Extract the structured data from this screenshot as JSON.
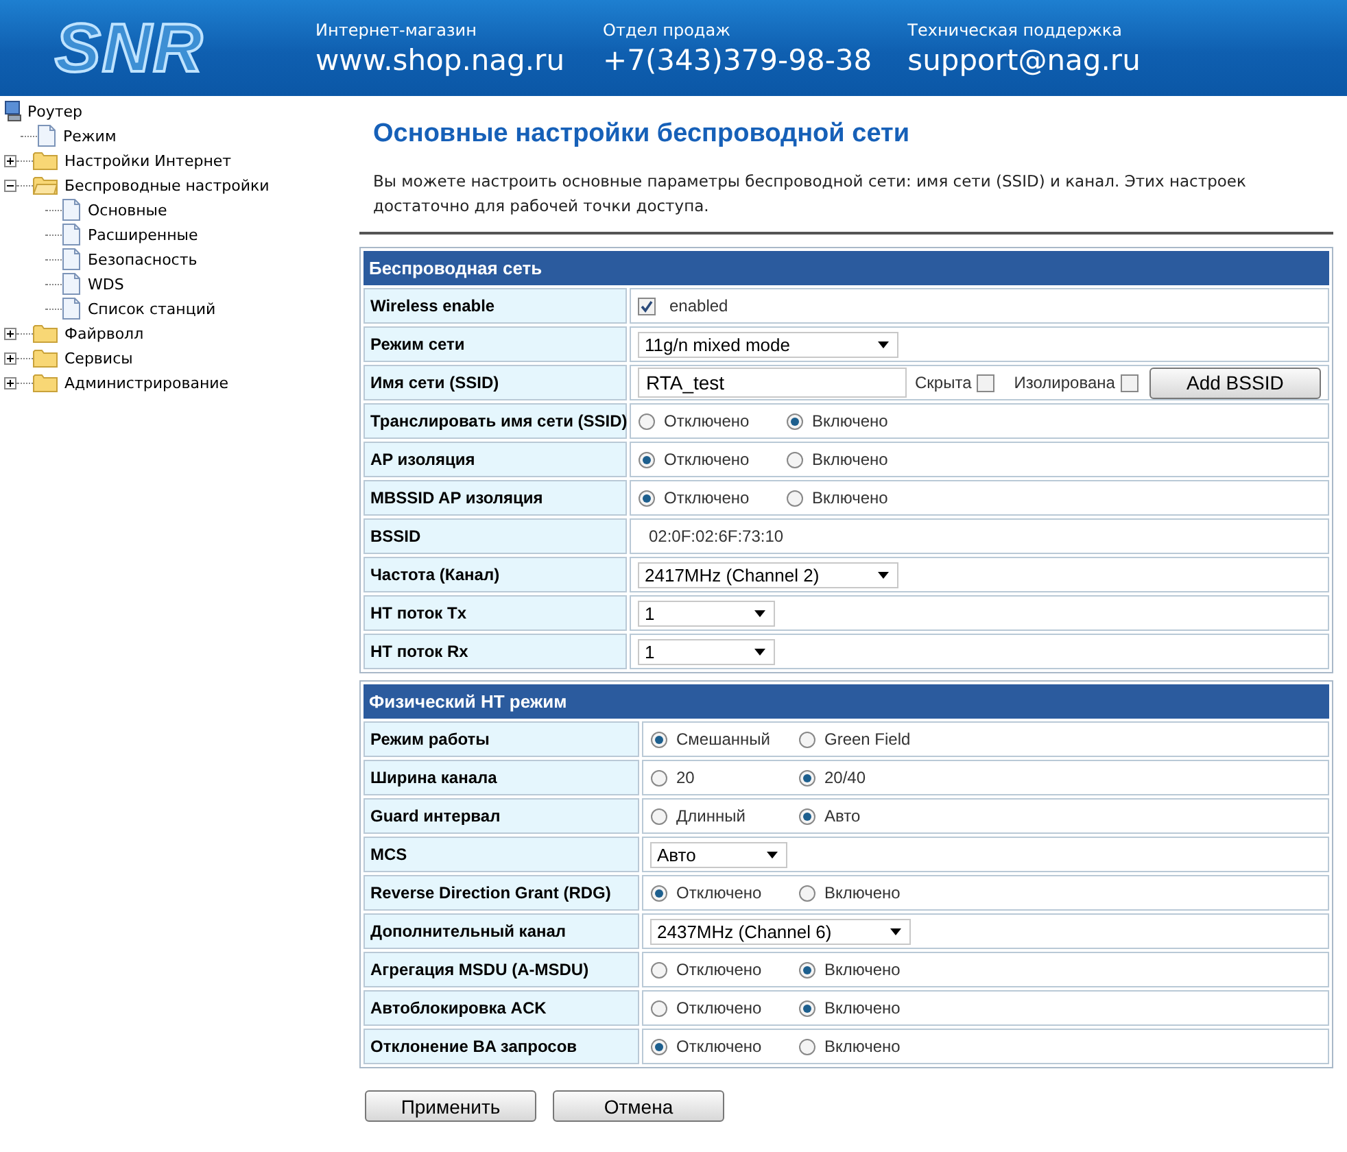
{
  "header": {
    "logo": "SNR",
    "contacts": [
      {
        "label": "Интернет-магазин",
        "value": "www.shop.nag.ru"
      },
      {
        "label": "Отдел продаж",
        "value": "+7(343)379-98-38"
      },
      {
        "label": "Техническая поддержка",
        "value": "support@nag.ru"
      }
    ]
  },
  "tree": {
    "label": "Роутер",
    "children": [
      {
        "kind": "page",
        "label": "Режим"
      },
      {
        "kind": "folder",
        "label": "Настройки Интернет",
        "expanded": false
      },
      {
        "kind": "folder",
        "label": "Беспроводные настройки",
        "expanded": true,
        "children": [
          {
            "kind": "page",
            "label": "Основные"
          },
          {
            "kind": "page",
            "label": "Расширенные"
          },
          {
            "kind": "page",
            "label": "Безопасность"
          },
          {
            "kind": "page",
            "label": "WDS"
          },
          {
            "kind": "page",
            "label": "Список станций"
          }
        ]
      },
      {
        "kind": "folder",
        "label": "Файрволл",
        "expanded": false
      },
      {
        "kind": "folder",
        "label": "Сервисы",
        "expanded": false
      },
      {
        "kind": "folder",
        "label": "Администрирование",
        "expanded": false
      }
    ]
  },
  "page": {
    "title": "Основные настройки беспроводной сети",
    "description": "Вы можете настроить основные параметры беспроводной сети: имя сети (SSID) и канал. Этих настроек достаточно для рабочей точки доступа."
  },
  "sections": [
    {
      "title": "Беспроводная сеть",
      "rows": [
        {
          "kind": "checkbox",
          "label": "Wireless enable",
          "checked": true,
          "text": "enabled"
        },
        {
          "kind": "select",
          "label": "Режим сети",
          "value": "11g/n mixed mode"
        },
        {
          "kind": "ssid",
          "label": "Имя сети (SSID)",
          "value": "RTA_test",
          "checkboxes": [
            {
              "label": "Скрыта",
              "checked": false
            },
            {
              "label": "Изолирована",
              "checked": false
            }
          ],
          "button": "Add BSSID"
        },
        {
          "kind": "radio",
          "label": "Транслировать имя сети (SSID)",
          "options": [
            {
              "label": "Отключено",
              "selected": false
            },
            {
              "label": "Включено",
              "selected": true
            }
          ]
        },
        {
          "kind": "radio",
          "label": "AP изоляция",
          "options": [
            {
              "label": "Отключено",
              "selected": true
            },
            {
              "label": "Включено",
              "selected": false
            }
          ]
        },
        {
          "kind": "radio",
          "label": "MBSSID AP изоляция",
          "options": [
            {
              "label": "Отключено",
              "selected": true
            },
            {
              "label": "Включено",
              "selected": false
            }
          ]
        },
        {
          "kind": "text",
          "label": "BSSID",
          "value": "02:0F:02:6F:73:10"
        },
        {
          "kind": "select",
          "label": "Частота (Канал)",
          "value": "2417MHz (Channel 2)"
        },
        {
          "kind": "select_short",
          "label": "HT поток Tx",
          "value": "1"
        },
        {
          "kind": "select_short",
          "label": "HT поток Rx",
          "value": "1"
        }
      ]
    },
    {
      "title": "Физический HT режим",
      "rows": [
        {
          "kind": "radio",
          "label": "Режим работы",
          "options": [
            {
              "label": "Смешанный",
              "selected": true
            },
            {
              "label": "Green Field",
              "selected": false
            }
          ]
        },
        {
          "kind": "radio",
          "label": "Ширина канала",
          "options": [
            {
              "label": "20",
              "selected": false
            },
            {
              "label": "20/40",
              "selected": true
            }
          ]
        },
        {
          "kind": "radio",
          "label": "Guard интервал",
          "options": [
            {
              "label": "Длинный",
              "selected": false
            },
            {
              "label": "Авто",
              "selected": true
            }
          ]
        },
        {
          "kind": "select_short",
          "label": "MCS",
          "value": "Авто"
        },
        {
          "kind": "radio",
          "label": "Reverse Direction Grant (RDG)",
          "options": [
            {
              "label": "Отключено",
              "selected": true
            },
            {
              "label": "Включено",
              "selected": false
            }
          ]
        },
        {
          "kind": "select",
          "label": "Дополнительный канал",
          "value": "2437MHz (Channel 6)"
        },
        {
          "kind": "radio",
          "label": "Агрегация MSDU (A-MSDU)",
          "options": [
            {
              "label": "Отключено",
              "selected": false
            },
            {
              "label": "Включено",
              "selected": true
            }
          ]
        },
        {
          "kind": "radio",
          "label": "Автоблокировка ACK",
          "options": [
            {
              "label": "Отключено",
              "selected": false
            },
            {
              "label": "Включено",
              "selected": true
            }
          ]
        },
        {
          "kind": "radio",
          "label": "Отклонение BA запросов",
          "options": [
            {
              "label": "Отключено",
              "selected": true
            },
            {
              "label": "Включено",
              "selected": false
            }
          ]
        }
      ]
    }
  ],
  "buttons": [
    "Применить",
    "Отмена"
  ]
}
